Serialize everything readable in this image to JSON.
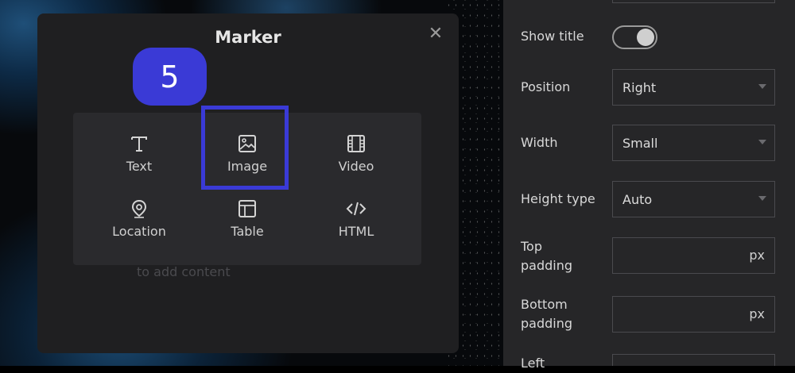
{
  "dialog": {
    "title": "Marker",
    "close_icon": "close-icon",
    "step_badge": "5",
    "content_types": [
      {
        "label": "Text",
        "icon": "text-icon"
      },
      {
        "label": "Image",
        "icon": "image-icon"
      },
      {
        "label": "Video",
        "icon": "video-icon"
      },
      {
        "label": "Location",
        "icon": "location-icon"
      },
      {
        "label": "Table",
        "icon": "table-icon"
      },
      {
        "label": "HTML",
        "icon": "code-icon"
      }
    ],
    "hint_text": "to add content"
  },
  "settings": {
    "show_title": {
      "label": "Show title",
      "value": true
    },
    "position": {
      "label": "Position",
      "value": "Right"
    },
    "width": {
      "label": "Width",
      "value": "Small"
    },
    "height_type": {
      "label": "Height type",
      "value": "Auto"
    },
    "top_padding": {
      "label_line1": "Top",
      "label_line2": "padding",
      "unit": "px"
    },
    "bottom_padding": {
      "label_line1": "Bottom",
      "label_line2": "padding",
      "unit": "px"
    },
    "left_padding": {
      "label_line1": "Left"
    }
  },
  "colors": {
    "accent": "#3a3ad6",
    "dialog_bg": "#1f1f21",
    "panel_bg": "#262628"
  }
}
